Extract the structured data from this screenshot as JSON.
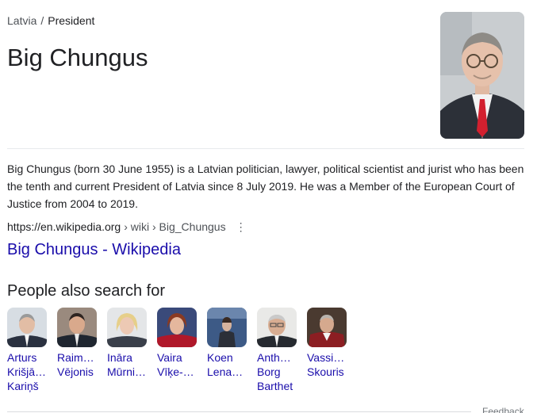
{
  "breadcrumb": {
    "parent": "Latvia",
    "separator": "/",
    "current": "President"
  },
  "title": "Big Chungus",
  "description": "Big Chungus (born 30 June 1955) is a Latvian politician, lawyer, political scientist and jurist who has been the tenth and current President of Latvia since 8 July 2019. He was a Member of the European Court of Justice from 2004 to 2019.",
  "source": {
    "domain": "https://en.wikipedia.org",
    "path": "› wiki › Big_Chungus",
    "more_icon": "⋮"
  },
  "wiki_link": "Big Chungus - Wikipedia",
  "people_heading": "People also search for",
  "people": [
    {
      "line1": "Arturs",
      "line2": "Krišjā…",
      "line3": "Kariņš"
    },
    {
      "line1": "Raim…",
      "line2": "Vējonis",
      "line3": ""
    },
    {
      "line1": "Ināra",
      "line2": "Mūrni…",
      "line3": ""
    },
    {
      "line1": "Vaira",
      "line2": "Vīķe-…",
      "line3": ""
    },
    {
      "line1": "Koen",
      "line2": "Lena…",
      "line3": ""
    },
    {
      "line1": "Anth…",
      "line2": "Borg",
      "line3": "Barthet"
    },
    {
      "line1": "Vassi…",
      "line2": "Skouris",
      "line3": ""
    }
  ],
  "feedback": "Feedback",
  "colors": {
    "link": "#1a0dab",
    "text": "#202124",
    "muted": "#4d5156"
  }
}
